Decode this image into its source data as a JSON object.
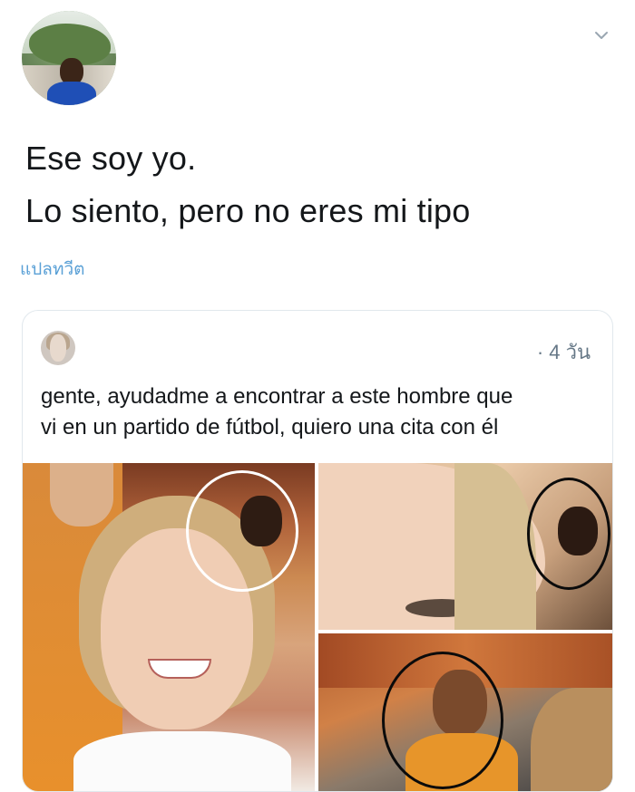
{
  "tweet": {
    "line1": "Ese soy yo.",
    "line2": "Lo siento, pero no eres mi tipo",
    "translate_label": "แปลทวีต"
  },
  "quoted_tweet": {
    "time": "· 4 วัน",
    "line1": "gente, ayudadme a encontrar a este hombre que",
    "line2": "vi en un partido de fútbol, quiero una cita con él"
  },
  "colors": {
    "text": "#14171a",
    "link": "#5aa0d6",
    "muted": "#657786",
    "border": "#e1e8ed"
  },
  "icons": {
    "more": "chevron-down-icon"
  }
}
